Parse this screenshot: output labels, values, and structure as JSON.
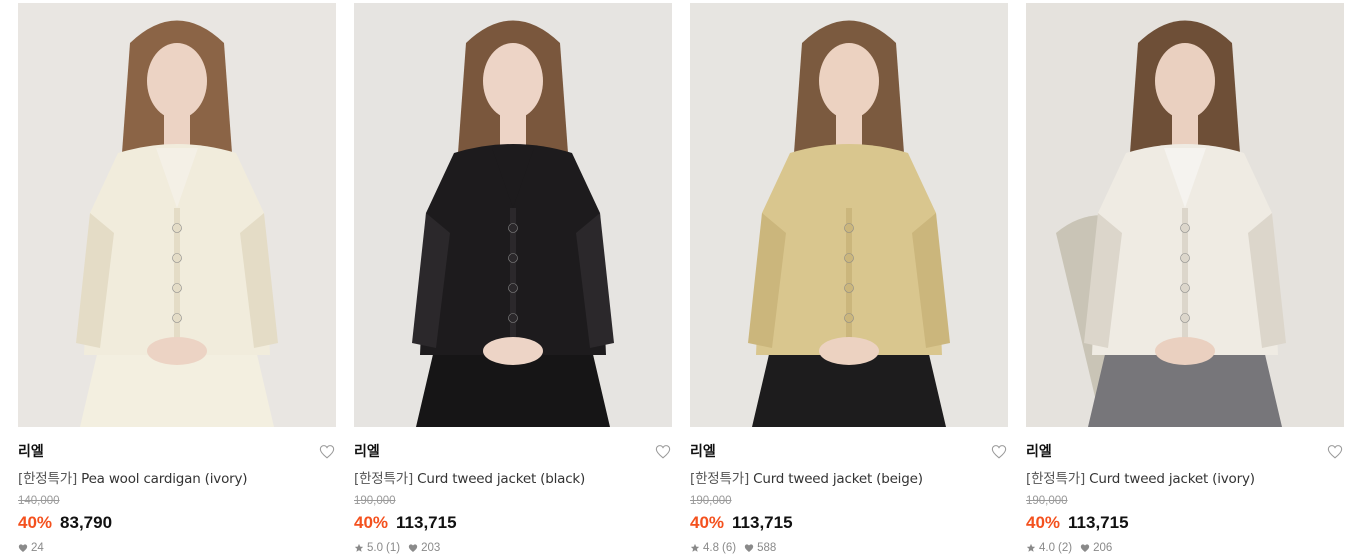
{
  "products": [
    {
      "brand": "리엘",
      "tag": "[한정특가]",
      "name": "Pea wool cardigan (ivory)",
      "original_price": "140,000",
      "discount": "40%",
      "price": "83,790",
      "rating": "",
      "review_count": "",
      "likes": "24",
      "image": {
        "background": "#e9e6e2",
        "garment": "#f1ecdc",
        "garment_shade": "#e4dcc6",
        "inner": "#f4f0e6",
        "bottom": "#f3efe0",
        "skin": "#ecd3c4",
        "hair": "#8b6446"
      }
    },
    {
      "brand": "리엘",
      "tag": "[한정특가]",
      "name": "Curd tweed jacket (black)",
      "original_price": "190,000",
      "discount": "40%",
      "price": "113,715",
      "rating": "5.0",
      "review_count": "(1)",
      "likes": "203",
      "image": {
        "background": "#e6e4e1",
        "garment": "#1d1b1d",
        "garment_shade": "#2b282b",
        "inner": "#1d1b1d",
        "bottom": "#161516",
        "skin": "#edd4c6",
        "hair": "#7a573d"
      }
    },
    {
      "brand": "리엘",
      "tag": "[한정특가]",
      "name": "Curd tweed jacket (beige)",
      "original_price": "190,000",
      "discount": "40%",
      "price": "113,715",
      "rating": "4.8",
      "review_count": "(6)",
      "likes": "588",
      "image": {
        "background": "#e7e5e1",
        "garment": "#d9c68e",
        "garment_shade": "#cbb67c",
        "inner": "#d9c68e",
        "bottom": "#1d1c1d",
        "skin": "#ecd2c1",
        "hair": "#7b5a3f"
      }
    },
    {
      "brand": "리엘",
      "tag": "[한정특가]",
      "name": "Curd tweed jacket (ivory)",
      "original_price": "190,000",
      "discount": "40%",
      "price": "113,715",
      "rating": "4.0",
      "review_count": "(2)",
      "likes": "206",
      "image": {
        "background": "#e5e2dd",
        "garment": "#efebe3",
        "garment_shade": "#dcd6cb",
        "inner": "#f5f3ef",
        "bottom": "#77767a",
        "skin": "#ead0c0",
        "hair": "#6e4f37"
      }
    }
  ]
}
